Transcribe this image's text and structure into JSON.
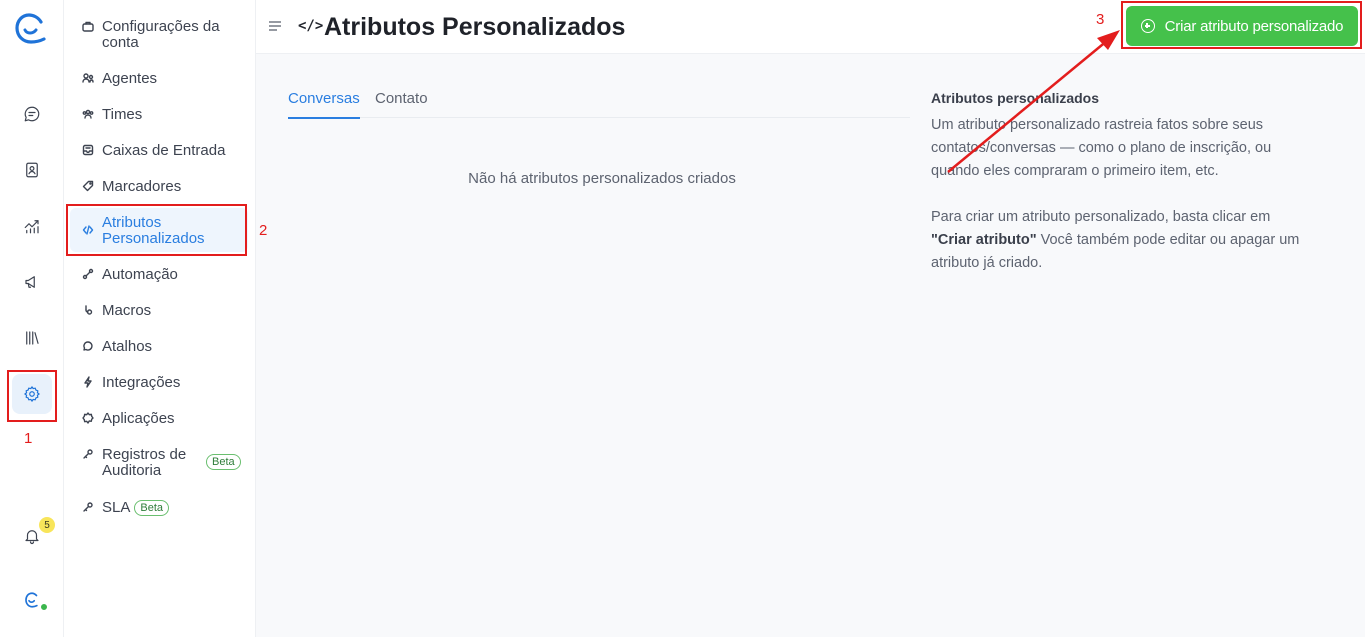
{
  "header": {
    "title": "Atributos Personalizados",
    "create_button": "Criar atributo personalizado"
  },
  "rail": {
    "items": [
      "chat-icon",
      "contacts-icon",
      "reports-icon",
      "campaigns-icon",
      "library-icon",
      "settings-icon"
    ],
    "notification_count": "5"
  },
  "sidebar": {
    "items": [
      {
        "label": "Configurações da conta",
        "icon": "briefcase-icon"
      },
      {
        "label": "Agentes",
        "icon": "people-icon"
      },
      {
        "label": "Times",
        "icon": "team-icon"
      },
      {
        "label": "Caixas de Entrada",
        "icon": "inbox-icon"
      },
      {
        "label": "Marcadores",
        "icon": "tag-icon"
      },
      {
        "label": "Atributos Personalizados",
        "icon": "code-icon"
      },
      {
        "label": "Automação",
        "icon": "automation-icon"
      },
      {
        "label": "Macros",
        "icon": "macro-icon"
      },
      {
        "label": "Atalhos",
        "icon": "chat-bubbles-icon"
      },
      {
        "label": "Integrações",
        "icon": "lightning-icon"
      },
      {
        "label": "Aplicações",
        "icon": "puzzle-icon"
      },
      {
        "label": "Registros de Auditoria",
        "icon": "key-icon",
        "badge": "Beta"
      },
      {
        "label": "SLA",
        "icon": "key-icon",
        "badge": "Beta"
      }
    ]
  },
  "main": {
    "tabs": [
      "Conversas",
      "Contato"
    ],
    "empty_message": "Não há atributos personalizados criados"
  },
  "info": {
    "title": "Atributos personalizados",
    "paragraph1": "Um atributo personalizado rastreia fatos sobre seus contatos/conversas — como o plano de inscrição, ou quando eles compraram o primeiro item, etc.",
    "paragraph2_prefix": "Para criar um atributo personalizado, basta clicar em ",
    "paragraph2_bold": "\"Criar atributo\"",
    "paragraph2_suffix": " Você também pode editar ou apagar um atributo já criado."
  },
  "annotations": [
    "1",
    "2",
    "3"
  ],
  "colors": {
    "accent": "#2a7ee0",
    "button_green": "#45c14b",
    "annotation_red": "#e31d1d"
  }
}
